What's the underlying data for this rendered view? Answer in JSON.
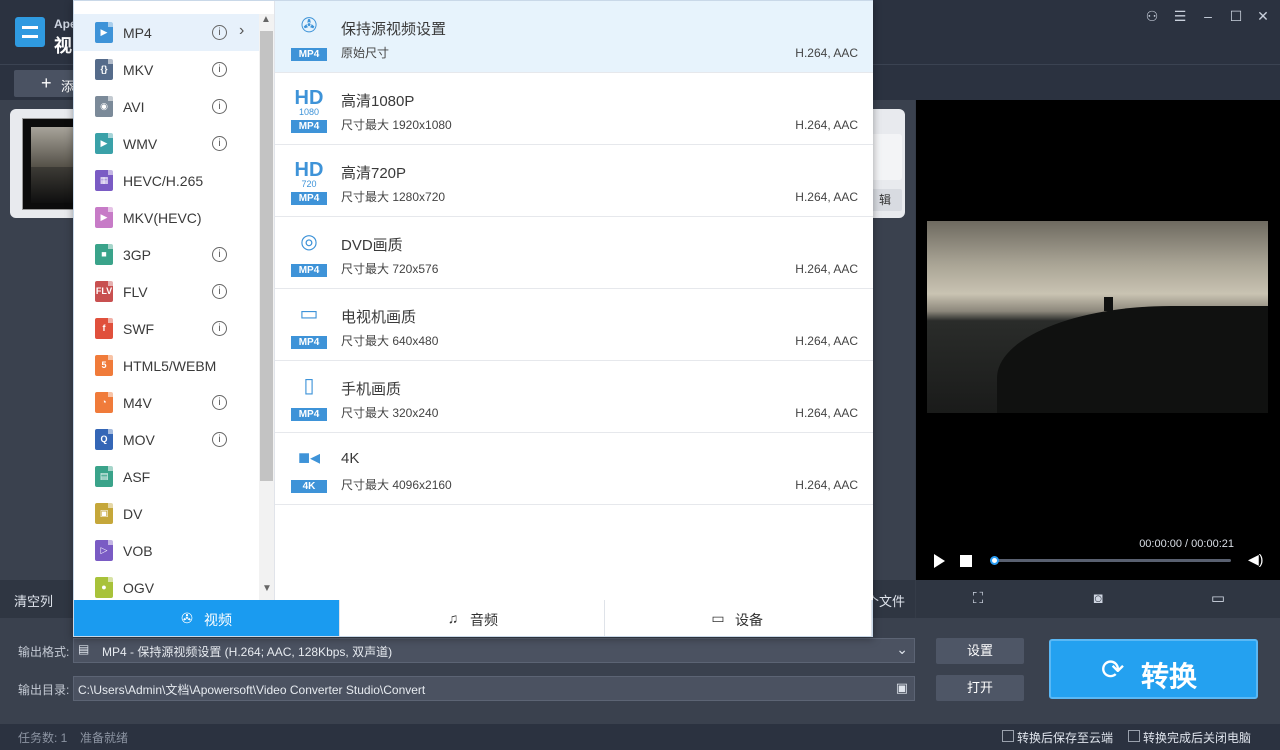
{
  "app": {
    "name_short": "Ape",
    "name_sub": "视"
  },
  "toolbar": {
    "add_label": "添"
  },
  "file": {
    "edit_label": "辑"
  },
  "listbar": {
    "clear_label": "清空列",
    "open_label": "个文件"
  },
  "preview": {
    "time_current": "00:00:00",
    "time_total": "00:00:21",
    "time_text": "00:00:00 / 00:00:21",
    "progress": 0
  },
  "settings": {
    "format_label": "输出格式:",
    "format_value": "MP4 - 保持源视频设置 (H.264; AAC, 128Kbps, 双声道)",
    "dir_label": "输出目录:",
    "dir_value": "C:\\Users\\Admin\\文档\\Apowersoft\\Video Converter Studio\\Convert",
    "settings_btn": "设置",
    "open_btn": "打开",
    "convert_btn": "转换"
  },
  "status": {
    "task_count": "任务数: 1",
    "ready": "准备就绪",
    "save_cloud": "转换后保存至云端",
    "shutdown": "转换完成后关闭电脑"
  },
  "format_panel": {
    "formats": [
      {
        "name": "MP4",
        "icon": "mp4-icon",
        "color": "#3e93d8",
        "badge": "▶"
      },
      {
        "name": "MKV",
        "icon": "mkv-icon",
        "color": "#556b8a",
        "badge": "{}"
      },
      {
        "name": "AVI",
        "icon": "avi-icon",
        "color": "#7b8a99",
        "badge": "◉"
      },
      {
        "name": "WMV",
        "icon": "wmv-icon",
        "color": "#3aa1a8",
        "badge": "▶"
      },
      {
        "name": "HEVC/H.265",
        "icon": "hevc-icon",
        "color": "#7a5bc4",
        "badge": "▦"
      },
      {
        "name": "MKV(HEVC)",
        "icon": "mkv-hevc-icon",
        "color": "#c77bc7",
        "badge": "▶"
      },
      {
        "name": "3GP",
        "icon": "3gp-icon",
        "color": "#3aa38a",
        "badge": "■"
      },
      {
        "name": "FLV",
        "icon": "flv-icon",
        "color": "#c85050",
        "badge": "FLV"
      },
      {
        "name": "SWF",
        "icon": "swf-icon",
        "color": "#e0503c",
        "badge": "f"
      },
      {
        "name": "HTML5/WEBM",
        "icon": "html5-icon",
        "color": "#f07b3a",
        "badge": "5"
      },
      {
        "name": "M4V",
        "icon": "m4v-icon",
        "color": "#f07b3a",
        "badge": "◔"
      },
      {
        "name": "MOV",
        "icon": "mov-icon",
        "color": "#3466b6",
        "badge": "Q"
      },
      {
        "name": "ASF",
        "icon": "asf-icon",
        "color": "#3aa38a",
        "badge": "▤"
      },
      {
        "name": "DV",
        "icon": "dv-icon",
        "color": "#c5a73a",
        "badge": "▣"
      },
      {
        "name": "VOB",
        "icon": "vob-icon",
        "color": "#7a5bc4",
        "badge": "▷"
      },
      {
        "name": "OGV",
        "icon": "ogv-icon",
        "color": "#a8c23a",
        "badge": "●"
      }
    ],
    "info_mark": "i",
    "presets": [
      {
        "title": "保持源视频设置",
        "res": "原始尺寸",
        "codec": "H.264, AAC",
        "glyph": "✇",
        "tag": "MP4",
        "icon": "film-reel-icon"
      },
      {
        "title": "高清1080P",
        "res": "尺寸最大  1920x1080",
        "codec": "H.264, AAC",
        "glyph": "HD",
        "tag": "MP4",
        "icon": "hd-1080-icon",
        "sub": "1080"
      },
      {
        "title": "高清720P",
        "res": "尺寸最大  1280x720",
        "codec": "H.264, AAC",
        "glyph": "HD",
        "tag": "MP4",
        "icon": "hd-720-icon",
        "sub": "720"
      },
      {
        "title": "DVD画质",
        "res": "尺寸最大  720x576",
        "codec": "H.264, AAC",
        "glyph": "◎",
        "tag": "MP4",
        "icon": "dvd-icon"
      },
      {
        "title": "电视机画质",
        "res": "尺寸最大  640x480",
        "codec": "H.264, AAC",
        "glyph": "▭",
        "tag": "MP4",
        "icon": "tv-icon"
      },
      {
        "title": "手机画质",
        "res": "尺寸最大  320x240",
        "codec": "H.264, AAC",
        "glyph": "▯",
        "tag": "MP4",
        "icon": "phone-icon"
      },
      {
        "title": "4K",
        "res": "尺寸最大  4096x2160",
        "codec": "H.264, AAC",
        "glyph": "■◂",
        "tag": "4K",
        "icon": "camera-icon"
      }
    ],
    "tabs": [
      {
        "label": "视频",
        "icon": "film-reel-icon",
        "glyph": "✇"
      },
      {
        "label": "音频",
        "icon": "headphones-icon",
        "glyph": "♫"
      },
      {
        "label": "设备",
        "icon": "devices-icon",
        "glyph": "▭"
      }
    ]
  }
}
